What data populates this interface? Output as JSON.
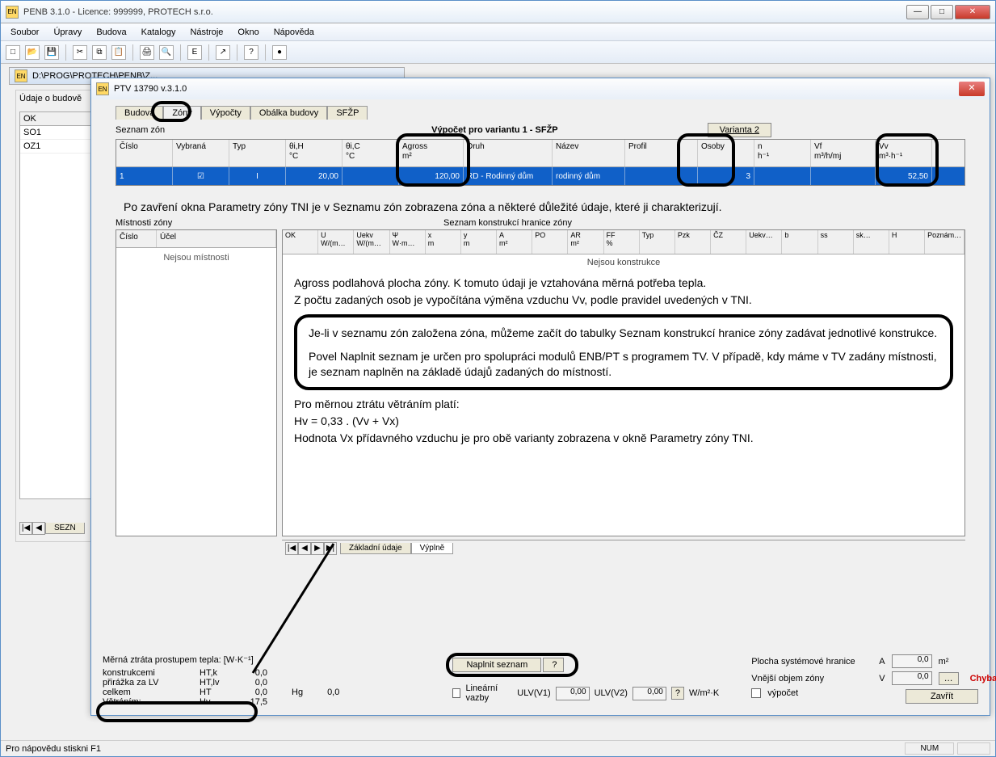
{
  "app": {
    "title": "PENB 3.1.0 -  Licence: 999999,  PROTECH s.r.o."
  },
  "menu": {
    "soubor": "Soubor",
    "upravy": "Úpravy",
    "budova": "Budova",
    "katalogy": "Katalogy",
    "nastroje": "Nástroje",
    "okno": "Okno",
    "napoveda": "Nápověda"
  },
  "child_title": "D:\\PROG\\PROTECH\\PENB\\Z...",
  "left_panel": {
    "label": "Údaje o budově",
    "col": "OK",
    "r1": "SO1",
    "r2": "OZ1",
    "tab": "SEZN"
  },
  "status": {
    "hint": "Pro nápovědu stiskni  F1",
    "num": "NUM"
  },
  "dialog": {
    "title": "PTV 13790  v.3.1.0",
    "tabs": {
      "budova": "Budova",
      "zony": "Zóny",
      "vypocty": "Výpočty",
      "obalka": "Obálka budovy",
      "sfzp": "SFŽP"
    },
    "seznam_label": "Seznam zón",
    "variant_title": "Výpočet pro variantu 1 - SFŽP",
    "variant_btn": "Varianta 2",
    "grid1": {
      "headers": {
        "cislo": "Číslo",
        "vybrana": "Vybraná",
        "typ": "Typ",
        "tih": "θi,H\n°C",
        "tic": "θi,C\n°C",
        "agross": "Agross\nm²",
        "druh": "Druh",
        "nazev": "Název",
        "profil": "Profil",
        "osoby": "Osoby",
        "n": "n\nh⁻¹",
        "vf": "Vf\nm³/h/mj",
        "vv": "Vv\nm³·h⁻¹"
      },
      "row": {
        "cislo": "1",
        "vybrana": "☑",
        "typ": "I",
        "tih": "20,00",
        "tic": "",
        "agross": "120,00",
        "druh": "RD - Rodinný dům",
        "nazev": "rodinný dům",
        "profil": "",
        "osoby": "3",
        "n": "",
        "vf": "",
        "vv": "52,50"
      }
    },
    "explain1": "Po zavření okna Parametry zóny TNI je v Seznamu zón zobrazena zóna a některé důležité údaje, které ji charakterizují.",
    "rooms": {
      "title": "Místnosti zóny",
      "h1": "Číslo",
      "h2": "Účel",
      "empty": "Nejsou místnosti"
    },
    "constr": {
      "title": "Seznam konstrukcí hranice zóny",
      "headers": [
        "OK",
        "U\nW/(m…",
        "Uekv\nW/(m…",
        "Ψ\nW·m…",
        "x\nm",
        "y\nm",
        "A\nm²",
        "PO",
        "AR\nm²",
        "FF\n%",
        "Typ",
        "Pzk",
        "ČZ",
        "Uekv…",
        "b",
        "ss",
        "sk…",
        "H",
        "Poznám…"
      ],
      "empty": "Nejsou konstrukce",
      "text1": "Agross podlahová plocha zóny. K tomuto údaji je vztahována měrná potřeba tepla.",
      "text2": "Z počtu zadaných osob je vypočítána výměna vzduchu Vv, podle pravidel uvedených v TNI.",
      "box1": "Je-li v seznamu zón založena zóna, můžeme začít do tabulky Seznam konstrukcí hranice zóny zadávat jednotlivé konstrukce.",
      "box2": "Povel Naplnit seznam je určen pro spolupráci modulů ENB/PT s programem TV. V případě, kdy máme v TV zadány místnosti, je seznam naplněn na základě údajů zadaných do místností.",
      "text3": "Pro měrnou ztrátu větráním platí:",
      "text4": "Hv = 0,33 . (Vv + Vx)",
      "text5": "Hodnota Vx přídavného vzduchu je pro obě varianty zobrazena v okně Parametry zóny TNI."
    },
    "bottom_tabs": {
      "t1": "Základní údaje",
      "t2": "Výplně"
    },
    "heat": {
      "title": "Měrná ztráta prostupem tepla: [W·K⁻¹]",
      "r1": {
        "l": "konstrukcemi",
        "s": "HT,k",
        "v": "0,0"
      },
      "r2": {
        "l": "přirážka za LV",
        "s": "HT,lv",
        "v": "0,0"
      },
      "r3": {
        "l": "celkem",
        "s": "HT",
        "v": "0,0"
      },
      "r4": {
        "l": "Větráním:",
        "s": "Hv",
        "v": "17,5"
      },
      "hg_sym": "Hg",
      "hg_val": "0,0"
    },
    "mid": {
      "fill": "Naplnit seznam",
      "q": "?",
      "lin": "Lineární vazby",
      "ulv1": "ULV(V1)",
      "ulv1_v": "0,00",
      "ulv2": "ULV(V2)",
      "ulv2_v": "0,00",
      "unit": "W/m²·K"
    },
    "right": {
      "r1": {
        "l": "Plocha systémové hranice",
        "s": "A",
        "v": "0,0",
        "u": "m²"
      },
      "r2": {
        "l": "Vnější objem zóny",
        "s": "V",
        "v": "0,0"
      },
      "chyba": "Chyba",
      "vypocet": "výpočet"
    },
    "close": "Zavřít"
  }
}
